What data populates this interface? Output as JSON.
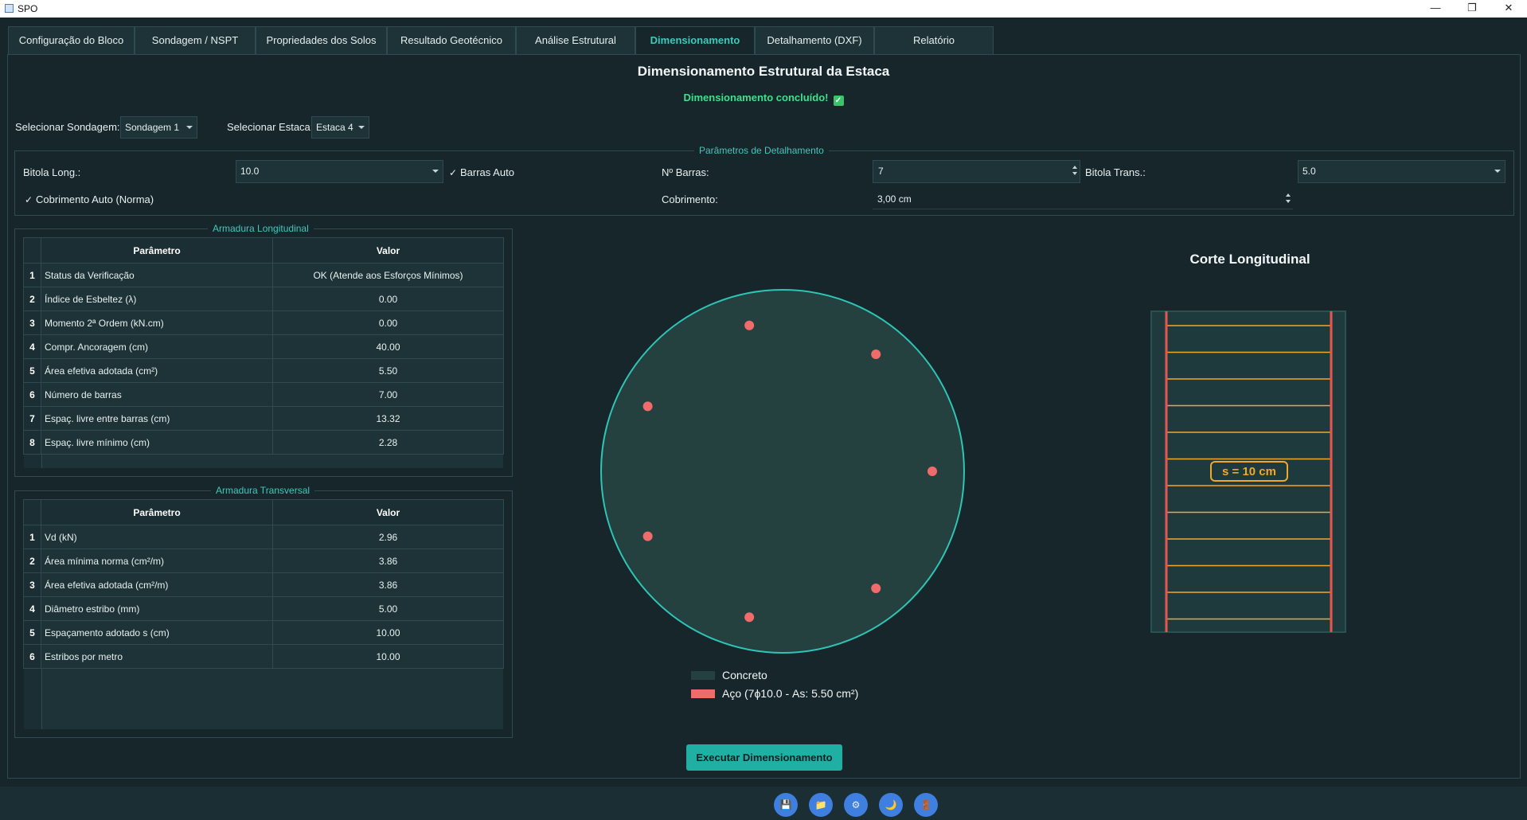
{
  "window": {
    "title": "SPO",
    "controls": {
      "minimize": "—",
      "restore": "❐",
      "close": "✕"
    }
  },
  "tabs": [
    {
      "label": "Configuração do Bloco"
    },
    {
      "label": "Sondagem / NSPT"
    },
    {
      "label": "Propriedades dos Solos"
    },
    {
      "label": "Resultado Geotécnico"
    },
    {
      "label": "Análise Estrutural"
    },
    {
      "label": "Dimensionamento",
      "active": true
    },
    {
      "label": "Detalhamento (DXF)"
    },
    {
      "label": "Relatório"
    }
  ],
  "header": {
    "title": "Dimensionamento Estrutural da Estaca",
    "status": "Dimensionamento concluído!",
    "status_icon": "check-box-icon"
  },
  "selectors": {
    "sondagem_label": "Selecionar Sondagem:",
    "sondagem_value": "Sondagem 1",
    "estaca_label": "Selecionar Estaca:",
    "estaca_value": "Estaca 4"
  },
  "detail_params": {
    "group_title": "Parâmetros de Detalhamento",
    "bitola_long_label": "Bitola Long.:",
    "bitola_long_value": "10.0",
    "barras_auto_label": "Barras Auto",
    "barras_auto_checked": true,
    "n_barras_label": "Nº Barras:",
    "n_barras_value": "7",
    "bitola_trans_label": "Bitola Trans.:",
    "bitola_trans_value": "5.0",
    "cobrimento_auto_label": "Cobrimento Auto (Norma)",
    "cobrimento_auto_checked": true,
    "cobrimento_label": "Cobrimento:",
    "cobrimento_value": "3,00 cm"
  },
  "long_reinforcement": {
    "group_title": "Armadura Longitudinal",
    "headers": [
      "Parâmetro",
      "Valor"
    ],
    "rows": [
      {
        "idx": "1",
        "param": "Status da Verificação",
        "value": "OK (Atende aos Esforços Mínimos)"
      },
      {
        "idx": "2",
        "param": "Índice de Esbeltez (λ)",
        "value": "0.00"
      },
      {
        "idx": "3",
        "param": "Momento 2ª Ordem (kN.cm)",
        "value": "0.00"
      },
      {
        "idx": "4",
        "param": "Compr. Ancoragem (cm)",
        "value": "40.00"
      },
      {
        "idx": "5",
        "param": "Área efetiva adotada (cm²)",
        "value": "5.50"
      },
      {
        "idx": "6",
        "param": "Número de barras",
        "value": "7.00"
      },
      {
        "idx": "7",
        "param": "Espaç. livre entre barras (cm)",
        "value": "13.32"
      },
      {
        "idx": "8",
        "param": "Espaç. livre mínimo (cm)",
        "value": "2.28"
      }
    ]
  },
  "trans_reinforcement": {
    "group_title": "Armadura Transversal",
    "headers": [
      "Parâmetro",
      "Valor"
    ],
    "rows": [
      {
        "idx": "1",
        "param": "Vd (kN)",
        "value": "2.96"
      },
      {
        "idx": "2",
        "param": "Área mínima norma (cm²/m)",
        "value": "3.86"
      },
      {
        "idx": "3",
        "param": "Área efetiva adotada (cm²/m)",
        "value": "3.86"
      },
      {
        "idx": "4",
        "param": "Diâmetro estribo (mm)",
        "value": "5.00"
      },
      {
        "idx": "5",
        "param": "Espaçamento adotado s (cm)",
        "value": "10.00"
      },
      {
        "idx": "6",
        "param": "Estribos por metro",
        "value": "10.00"
      }
    ]
  },
  "cross_section": {
    "bar_count": 7,
    "legend": [
      {
        "label": "Concreto",
        "color": "#24413f"
      },
      {
        "label": "Aço (7ϕ10.0 - As: 5.50 cm²)",
        "color": "#f26b6b"
      }
    ],
    "colors": {
      "outline": "#2ec4b6",
      "fill": "#24413f",
      "bars": "#f26b6b"
    }
  },
  "longitudinal_section": {
    "title": "Corte Longitudinal",
    "spacing_label": "s = 10 cm",
    "stirrup_count": 12,
    "colors": {
      "bars": "#e8554e",
      "stirrups": "#f0a82a",
      "fill": "#1f3a3d"
    }
  },
  "actions": {
    "run_label": "Executar Dimensionamento"
  },
  "footer_buttons": [
    {
      "icon": "save-icon",
      "glyph": "💾"
    },
    {
      "icon": "folder-icon",
      "glyph": "📁"
    },
    {
      "icon": "settings-icon",
      "glyph": "⚙"
    },
    {
      "icon": "moon-icon",
      "glyph": "🌙"
    },
    {
      "icon": "exit-icon",
      "glyph": "🚪"
    }
  ],
  "accent_color": "#3fc9bb"
}
